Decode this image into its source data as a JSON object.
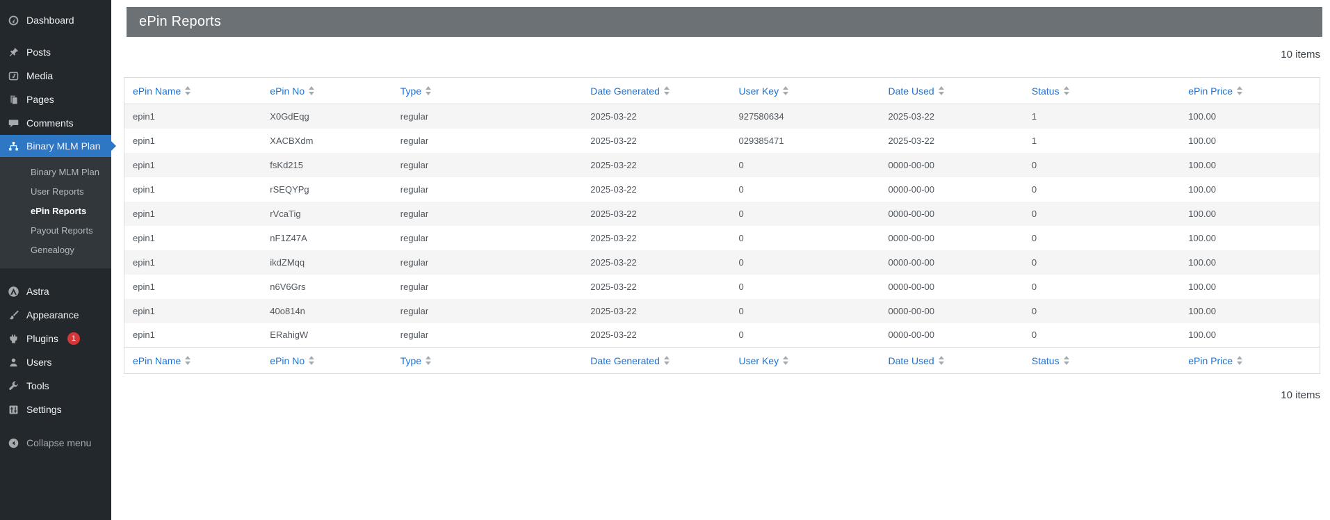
{
  "sidebar": {
    "items": [
      {
        "label": "Dashboard"
      },
      {
        "label": "Posts"
      },
      {
        "label": "Media"
      },
      {
        "label": "Pages"
      },
      {
        "label": "Comments"
      },
      {
        "label": "Binary MLM Plan"
      }
    ],
    "submenu": [
      {
        "label": "Binary MLM Plan"
      },
      {
        "label": "User Reports"
      },
      {
        "label": "ePin Reports",
        "current": true
      },
      {
        "label": "Payout Reports"
      },
      {
        "label": "Genealogy"
      }
    ],
    "lower_items": [
      {
        "label": "Astra"
      },
      {
        "label": "Appearance"
      },
      {
        "label": "Plugins",
        "badge": "1"
      },
      {
        "label": "Users"
      },
      {
        "label": "Tools"
      },
      {
        "label": "Settings"
      }
    ],
    "collapse_label": "Collapse menu"
  },
  "page": {
    "title": "ePin Reports"
  },
  "summary": {
    "top": "10 items",
    "bottom": "10 items"
  },
  "table": {
    "columns": [
      "ePin Name",
      "ePin No",
      "Type",
      "Date Generated",
      "User Key",
      "Date Used",
      "Status",
      "ePin Price"
    ],
    "column_widths_pct": [
      11.5,
      10.9,
      15.9,
      12.4,
      12.5,
      12.0,
      13.1,
      11.7
    ],
    "rows": [
      [
        "epin1",
        "X0GdEqg",
        "regular",
        "2025-03-22",
        "927580634",
        "2025-03-22",
        "1",
        "100.00"
      ],
      [
        "epin1",
        "XACBXdm",
        "regular",
        "2025-03-22",
        "029385471",
        "2025-03-22",
        "1",
        "100.00"
      ],
      [
        "epin1",
        "fsKd215",
        "regular",
        "2025-03-22",
        "0",
        "0000-00-00",
        "0",
        "100.00"
      ],
      [
        "epin1",
        "rSEQYPg",
        "regular",
        "2025-03-22",
        "0",
        "0000-00-00",
        "0",
        "100.00"
      ],
      [
        "epin1",
        "rVcaTig",
        "regular",
        "2025-03-22",
        "0",
        "0000-00-00",
        "0",
        "100.00"
      ],
      [
        "epin1",
        "nF1Z47A",
        "regular",
        "2025-03-22",
        "0",
        "0000-00-00",
        "0",
        "100.00"
      ],
      [
        "epin1",
        "ikdZMqq",
        "regular",
        "2025-03-22",
        "0",
        "0000-00-00",
        "0",
        "100.00"
      ],
      [
        "epin1",
        "n6V6Grs",
        "regular",
        "2025-03-22",
        "0",
        "0000-00-00",
        "0",
        "100.00"
      ],
      [
        "epin1",
        "40o814n",
        "regular",
        "2025-03-22",
        "0",
        "0000-00-00",
        "0",
        "100.00"
      ],
      [
        "epin1",
        "ERahigW",
        "regular",
        "2025-03-22",
        "0",
        "0000-00-00",
        "0",
        "100.00"
      ]
    ]
  },
  "colors": {
    "sidebar_bg": "#23282d",
    "submenu_bg": "#32373c",
    "selected_menu_blue": "#2d77c5",
    "header_bar_grey": "#6c7176",
    "column_link_blue": "#1a73d9",
    "plugins_badge_red": "#d63638",
    "row_stripe": "#f5f5f5",
    "table_border": "#d9dcde",
    "body_text": "#50575e"
  }
}
